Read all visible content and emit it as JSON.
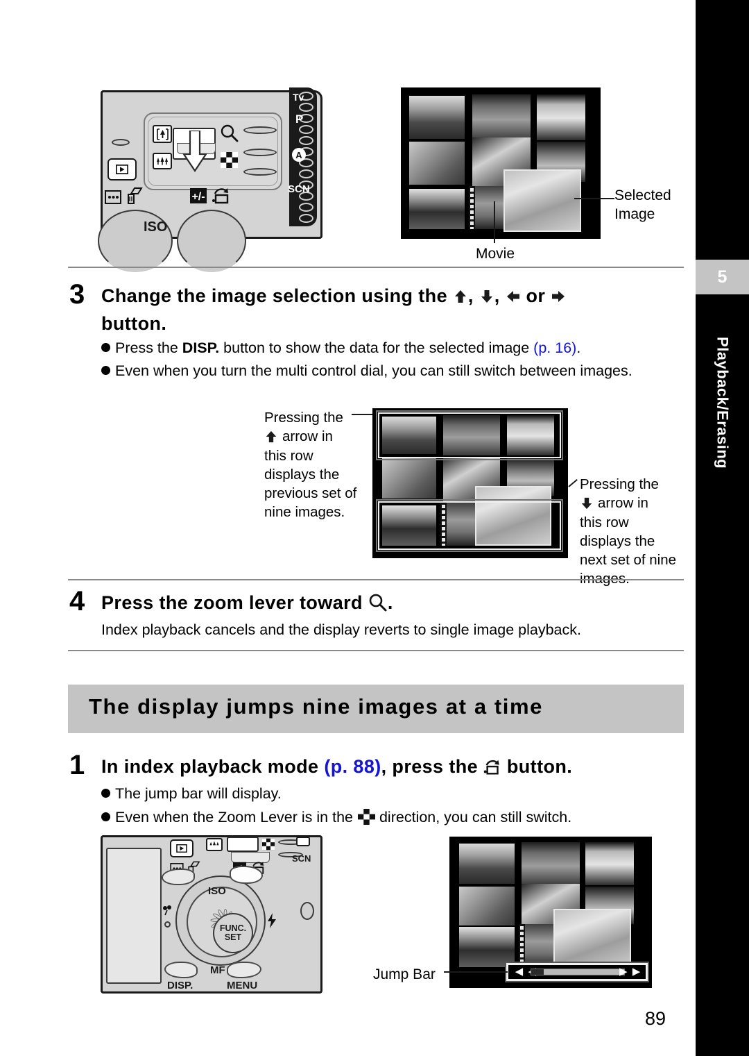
{
  "sidebar": {
    "chapter_number": "5",
    "chapter_label": "Playback/Erasing"
  },
  "page_number": "89",
  "top_figure": {
    "camera_caption_icons": [
      "tele-zoom-icon",
      "wide-zoom-icon",
      "magnify-icon",
      "index-icon",
      "playback-icon",
      "iso-dial"
    ],
    "mode_dial_letters": [
      "Tv",
      "P",
      "A",
      "SCN"
    ],
    "iso_label": "ISO",
    "callouts": {
      "selected_image": "Selected\nImage",
      "selected_image_line1": "Selected",
      "selected_image_line2": "Image",
      "movie": "Movie"
    }
  },
  "step3": {
    "number": "3",
    "heading_part1": "Change the image selection using the",
    "heading_sep1": ",",
    "heading_sep2": ",",
    "heading_or": "or",
    "heading_part2": "button.",
    "bullets": [
      {
        "pre": "Press the ",
        "bold": "DISP.",
        "mid": " button to show the data for the selected image ",
        "link": "(p. 16)",
        "post": "."
      },
      {
        "text": "Even when you turn the multi control dial, you can still switch between images."
      }
    ],
    "annotation_left": "Pressing the        arrow in this row displays the previous set of nine images.",
    "annotation_left_lines": [
      "Pressing the",
      "arrow in",
      "this row",
      "displays the",
      "previous set of",
      "nine images."
    ],
    "annotation_right_lines": [
      "Pressing the",
      "arrow in",
      "this row",
      "displays the",
      "next set of nine",
      "images."
    ]
  },
  "step4": {
    "number": "4",
    "heading_part1": "Press the zoom lever toward",
    "heading_part2": ".",
    "body": "Index playback cancels and the display reverts to single image playback."
  },
  "section": {
    "title": "The display jumps nine images at a time"
  },
  "step1": {
    "number": "1",
    "heading_part1": "In index playback mode",
    "heading_link": "(p. 88)",
    "heading_part2": ", press the",
    "heading_part3": "button.",
    "bullets": [
      {
        "text": "The jump bar will display."
      },
      {
        "pre": "Even when the Zoom Lever is in the",
        "post": "direction, you can still switch."
      }
    ]
  },
  "bottom_figure": {
    "wheel_center_line1": "FUNC.",
    "wheel_center_line2": "SET",
    "labels": {
      "iso": "ISO",
      "mf": "MF",
      "disp": "DISP.",
      "menu": "MENU",
      "scn": "SCN"
    },
    "jump_bar_callout": "Jump Bar"
  },
  "colors": {
    "accent_link": "#1414d2",
    "section_bar": "#c4c4c4",
    "sidebar": "#000000",
    "camera_body": "#d4d4d4"
  }
}
